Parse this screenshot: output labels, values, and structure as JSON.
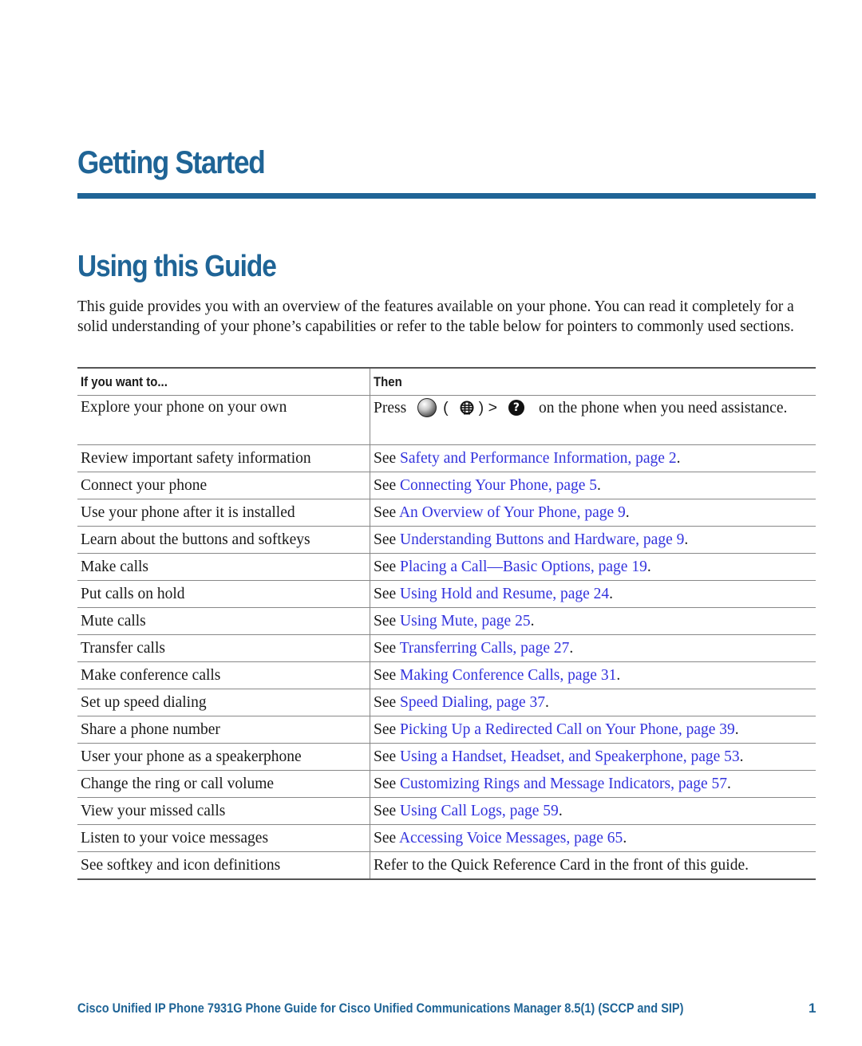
{
  "chapter_title": "Getting Started",
  "section_title": "Using this Guide",
  "intro": "This guide provides you with an overview of the features available on your phone. You can read it completely for a solid understanding of your phone’s capabilities or refer to the table below for pointers to commonly used sections.",
  "table": {
    "headers": [
      "If you want to...",
      "Then"
    ],
    "first_row": {
      "want": "Explore your phone on your own",
      "press": "Press",
      "open_paren": "(",
      "close_paren_gt": ") >",
      "after_icons": "on the phone when you need assistance.",
      "icons": [
        "applications-button-icon",
        "globe-icon",
        "help-icon"
      ],
      "help_glyph": "?"
    },
    "rows": [
      {
        "want": "Review important safety information",
        "prefix": "See ",
        "link": "Safety and Performance Information, page 2",
        "suffix": "."
      },
      {
        "want": "Connect your phone",
        "prefix": "See ",
        "link": "Connecting Your Phone, page 5",
        "suffix": "."
      },
      {
        "want": "Use your phone after it is installed",
        "prefix": "See ",
        "link": "An Overview of Your Phone, page 9",
        "suffix": "."
      },
      {
        "want": "Learn about the buttons and softkeys",
        "prefix": "See ",
        "link": "Understanding Buttons and Hardware, page 9",
        "suffix": "."
      },
      {
        "want": "Make calls",
        "prefix": "See ",
        "link": "Placing a Call—Basic Options, page 19",
        "suffix": "."
      },
      {
        "want": "Put calls on hold",
        "prefix": "See ",
        "link": "Using Hold and Resume, page 24",
        "suffix": "."
      },
      {
        "want": "Mute calls",
        "prefix": "See ",
        "link": "Using Mute, page 25",
        "suffix": "."
      },
      {
        "want": "Transfer calls",
        "prefix": "See ",
        "link": "Transferring Calls, page 27",
        "suffix": "."
      },
      {
        "want": "Make conference calls",
        "prefix": "See ",
        "link": "Making Conference Calls, page 31",
        "suffix": "."
      },
      {
        "want": "Set up speed dialing",
        "prefix": "See ",
        "link": "Speed Dialing, page 37",
        "suffix": "."
      },
      {
        "want": "Share a phone number",
        "prefix": "See ",
        "link": "Picking Up a Redirected Call on Your Phone, page 39",
        "suffix": "."
      },
      {
        "want": "User your phone as a speakerphone",
        "prefix": "See ",
        "link": "Using a Handset, Headset, and Speakerphone, page 53",
        "suffix": "."
      },
      {
        "want": "Change the ring or call volume",
        "prefix": "See ",
        "link": "Customizing Rings and Message Indicators, page 57",
        "suffix": "."
      },
      {
        "want": "View your missed calls",
        "prefix": "See ",
        "link": "Using Call Logs, page 59",
        "suffix": "."
      },
      {
        "want": "Listen to your voice messages",
        "prefix": "See ",
        "link": "Accessing Voice Messages, page 65",
        "suffix": "."
      }
    ],
    "last_row": {
      "want": "See softkey and icon definitions",
      "then": "Refer to the Quick Reference Card in the front of this guide."
    }
  },
  "footer": {
    "title": "Cisco Unified IP Phone 7931G Phone Guide for Cisco Unified Communications Manager 8.5(1) (SCCP and SIP)",
    "page_number": "1"
  },
  "colors": {
    "heading": "#1f6496",
    "link": "#3333dd",
    "text": "#1a1a1a"
  }
}
